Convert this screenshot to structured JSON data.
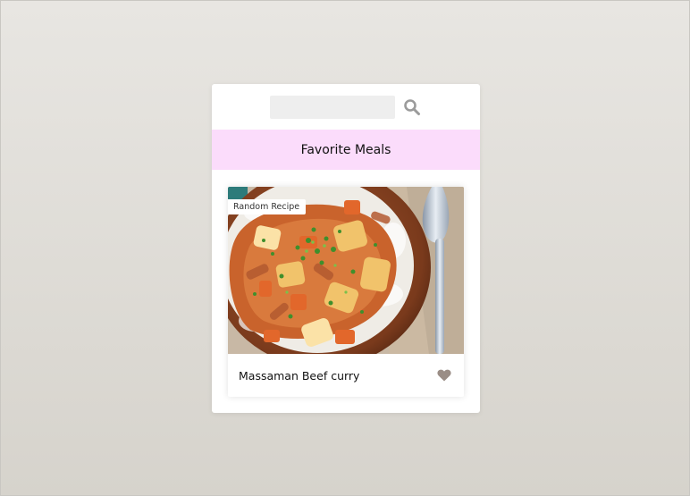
{
  "search": {
    "value": "",
    "placeholder": "",
    "icon": "search-icon"
  },
  "favorites": {
    "title": "Favorite Meals"
  },
  "meal": {
    "badge": "Random Recipe",
    "name": "Massaman Beef curry",
    "favorite_icon": "heart-icon",
    "favorited": false
  },
  "colors": {
    "band": "#fbdcfb",
    "heart": "#9a8d86",
    "search_icon": "#9b9b9b"
  }
}
